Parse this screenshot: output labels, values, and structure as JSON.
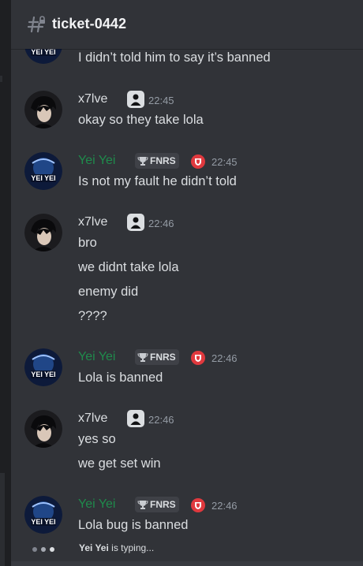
{
  "channel": {
    "name": "ticket-0442",
    "icon": "hash-icon"
  },
  "users": {
    "x7lve": {
      "name": "x7lve",
      "color": "#dbdee1",
      "badge_icon": "person-badge-icon"
    },
    "yeiyei": {
      "name": "Yei Yei",
      "color": "#1f8b4c",
      "tag": "FNRS",
      "tag_icon": "trophy-icon",
      "badge_icon": "red-shield-badge-icon"
    }
  },
  "messages": [
    {
      "author": "Yei Yei",
      "time": "",
      "lines": [
        "I didn’t told him to say it’s banned"
      ]
    },
    {
      "author": "x7lve",
      "time": "22:45",
      "lines": [
        "okay so they take lola"
      ]
    },
    {
      "author": "Yei Yei",
      "time": "22:45",
      "lines": [
        "Is not my fault he didn’t told"
      ]
    },
    {
      "author": "x7lve",
      "time": "22:46",
      "lines": [
        "bro",
        "we didnt take lola",
        "enemy did",
        "????"
      ]
    },
    {
      "author": "Yei Yei",
      "time": "22:46",
      "lines": [
        "Lola is banned"
      ]
    },
    {
      "author": "x7lve",
      "time": "22:46",
      "lines": [
        "yes so",
        "we get set win"
      ]
    },
    {
      "author": "Yei Yei",
      "time": "22:46",
      "lines": [
        "Lola bug is banned"
      ]
    }
  ],
  "typing": {
    "user": "Yei Yei",
    "text": " is typing..."
  }
}
